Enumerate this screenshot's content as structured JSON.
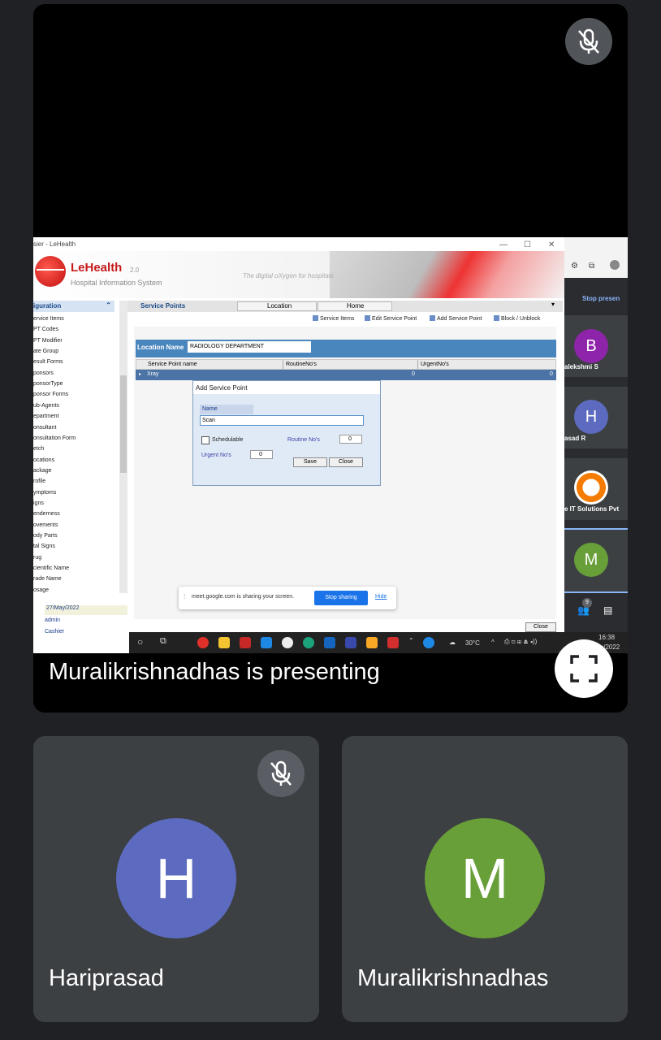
{
  "presentation": {
    "presenting_text": "Muralikrishnadhas is presenting"
  },
  "app": {
    "window_title": "sier - LeHealth",
    "logo_name": "LeHealth",
    "logo_version": "2.0",
    "logo_subtitle": "Hospital Information System",
    "tagline": "The digital oXygen for hospitals",
    "nav_header": "iguration",
    "nav_items": [
      "ervice Items",
      "PT Codes",
      "PT Modifier",
      "ate Group",
      "esult Forms",
      "ponsors",
      "ponsorType",
      "ponsor Forms",
      "ub-Agents",
      "epartment",
      "onsultant",
      "onsultation Form",
      "etch",
      "ocations",
      "ackage",
      "rofile",
      "ymptoms",
      "igns",
      "enderness",
      "ovements",
      "ody Parts",
      "tal Signs",
      "rug",
      "cientific Name",
      "rade Name",
      "osage"
    ],
    "info_date": "27/May/2022",
    "info_user": "admin",
    "info_role": "Cashier",
    "tabs": [
      "Service Points",
      "Location",
      "Home"
    ],
    "toolbar": [
      "Service Items",
      "Edit Service Point",
      "Add Service Point",
      "Block / Unblock"
    ],
    "location_label": "Location Name",
    "location_value": "RADIOLOGY DEPARTMENT",
    "grid_headers": [
      "Service Point name",
      "RoutineNo's",
      "UrgentNo's"
    ],
    "grid_row": [
      "Xray",
      "0",
      "0"
    ],
    "close_label": "Close"
  },
  "dialog": {
    "title": "Add Service Point",
    "name_label": "Name",
    "name_value": "Scan",
    "schedulable_label": "Schedulable",
    "routine_label": "Routine No's",
    "routine_value": "0",
    "urgent_label": "Urgent No's",
    "urgent_value": "0",
    "save_label": "Save",
    "close_label": "Close"
  },
  "share_bar": {
    "message": "meet.google.com is sharing your screen.",
    "stop_label": "Stop sharing",
    "hide_label": "Hide"
  },
  "taskbar": {
    "weather": "30°C",
    "time": "16:38",
    "date": "27/May/2022"
  },
  "inner_meet": {
    "stop_presenting": "Stop presen",
    "participants": [
      {
        "initial": "B",
        "name": "alekshmi S",
        "color": "#8e24aa"
      },
      {
        "initial": "H",
        "name": "asad R",
        "color": "#5c6bc0"
      },
      {
        "initial": "",
        "name": "e IT Solutions Pvt",
        "color": "#ffffff"
      },
      {
        "initial": "M",
        "name": "",
        "color": "#689f38"
      }
    ],
    "people_count": "9"
  },
  "tiles": [
    {
      "initial": "H",
      "name": "Hariprasad",
      "color": "#5c6bc0",
      "muted": true
    },
    {
      "initial": "M",
      "name": "Muralikrishnadhas",
      "color": "#689f38",
      "muted": false
    }
  ]
}
